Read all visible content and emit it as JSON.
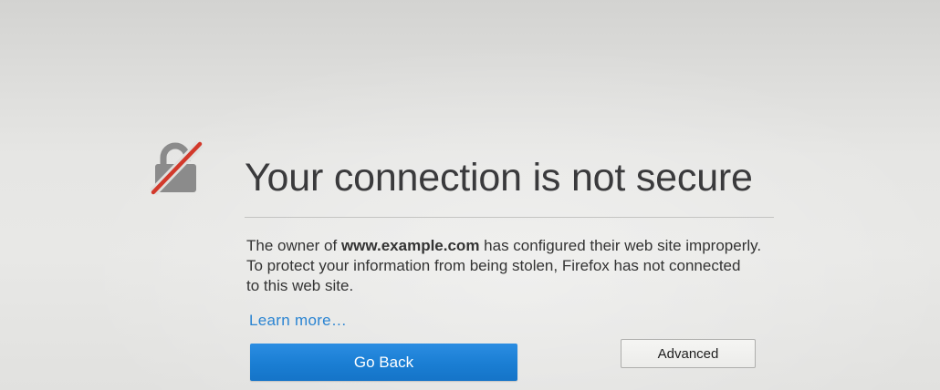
{
  "page": {
    "title": "Your connection is not secure"
  },
  "icon": "broken-lock-icon",
  "description": {
    "line1_prefix": "The owner of ",
    "domain": "www.example.com",
    "line1_suffix": " has configured their web site improperly.",
    "line2": "To protect your information from being stolen, Firefox has not connected",
    "line3": "to this web site."
  },
  "links": {
    "learn_more": "Learn more…"
  },
  "buttons": {
    "go_back": "Go Back",
    "advanced": "Advanced"
  },
  "colors": {
    "accent": "#1b7fd4",
    "link": "#2a84d2",
    "slash": "#d2392b",
    "lock": "#8b8b8b"
  }
}
